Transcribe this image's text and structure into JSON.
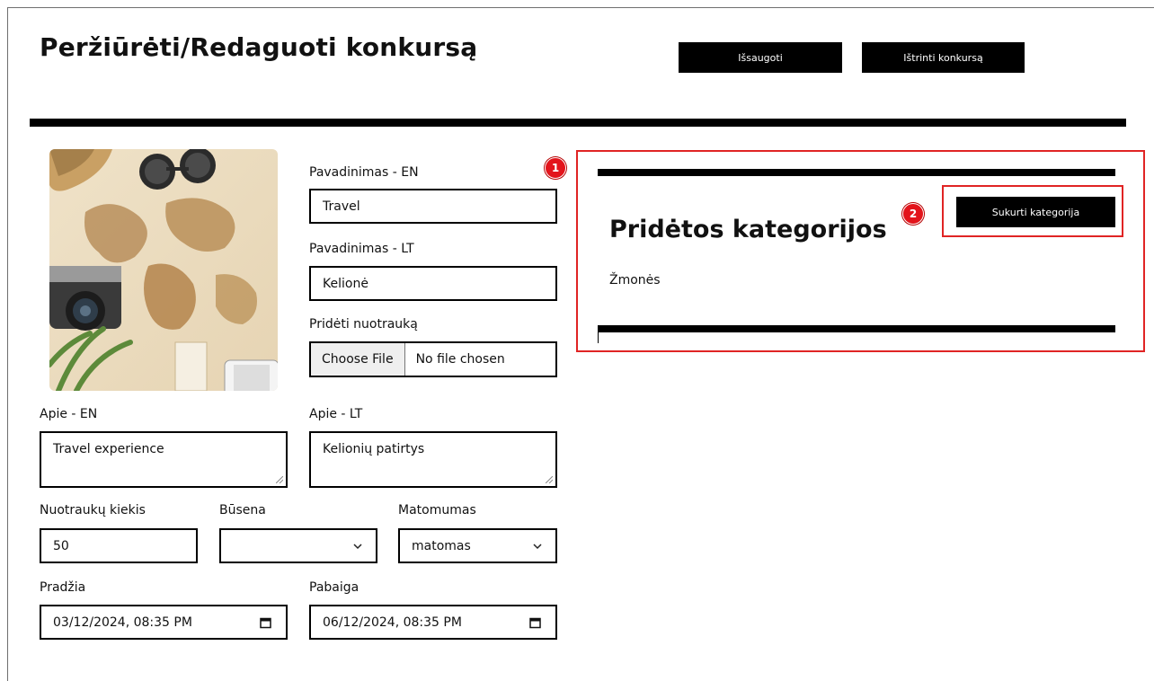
{
  "header": {
    "title": "Peržiūrėti/Redaguoti konkursą",
    "save_label": "Išsaugoti",
    "delete_label": "Ištrinti konkursą"
  },
  "form": {
    "name_en": {
      "label": "Pavadinimas - EN",
      "value": "Travel"
    },
    "name_lt": {
      "label": "Pavadinimas - LT",
      "value": "Kelionė"
    },
    "photo": {
      "label": "Pridėti nuotrauką",
      "button": "Choose File",
      "status": "No file chosen"
    },
    "about_en": {
      "label": "Apie - EN",
      "value": "Travel experience"
    },
    "about_lt": {
      "label": "Apie - LT",
      "value": "Kelionių patirtys"
    },
    "photo_count": {
      "label": "Nuotraukų kiekis",
      "value": "50"
    },
    "status": {
      "label": "Būsena",
      "value": ""
    },
    "visibility": {
      "label": "Matomumas",
      "value": "matomas"
    },
    "start": {
      "label": "Pradžia",
      "value": "03/12/2024, 08:35 PM"
    },
    "end": {
      "label": "Pabaiga",
      "value": "06/12/2024, 08:35 PM"
    }
  },
  "categories": {
    "title": "Pridėtos kategorijos",
    "create_label": "Sukurti kategorija",
    "items": [
      "Žmonės"
    ]
  },
  "annotations": {
    "badge_1": "1",
    "badge_2": "2"
  },
  "colors": {
    "accent_black": "#000000",
    "highlight_red": "#e02424",
    "badge_red": "#e3141b"
  }
}
